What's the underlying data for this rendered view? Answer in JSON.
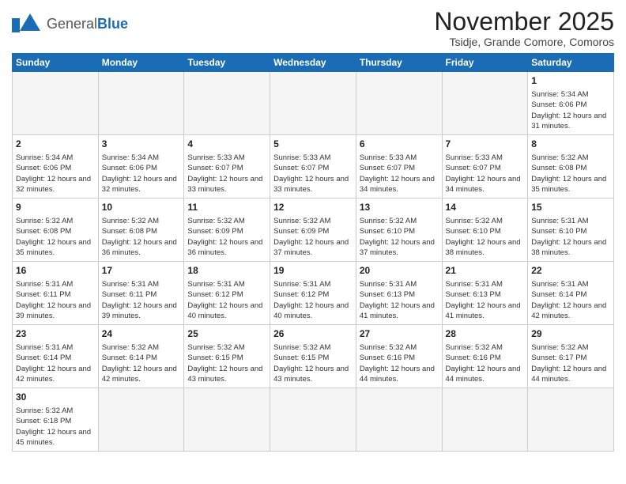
{
  "header": {
    "logo_general": "General",
    "logo_blue": "Blue",
    "month_title": "November 2025",
    "subtitle": "Tsidje, Grande Comore, Comoros"
  },
  "days_of_week": [
    "Sunday",
    "Monday",
    "Tuesday",
    "Wednesday",
    "Thursday",
    "Friday",
    "Saturday"
  ],
  "weeks": [
    [
      {
        "date": "",
        "info": ""
      },
      {
        "date": "",
        "info": ""
      },
      {
        "date": "",
        "info": ""
      },
      {
        "date": "",
        "info": ""
      },
      {
        "date": "",
        "info": ""
      },
      {
        "date": "",
        "info": ""
      },
      {
        "date": "1",
        "info": "Sunrise: 5:34 AM\nSunset: 6:06 PM\nDaylight: 12 hours and 31 minutes."
      }
    ],
    [
      {
        "date": "2",
        "info": "Sunrise: 5:34 AM\nSunset: 6:06 PM\nDaylight: 12 hours and 32 minutes."
      },
      {
        "date": "3",
        "info": "Sunrise: 5:34 AM\nSunset: 6:06 PM\nDaylight: 12 hours and 32 minutes."
      },
      {
        "date": "4",
        "info": "Sunrise: 5:33 AM\nSunset: 6:07 PM\nDaylight: 12 hours and 33 minutes."
      },
      {
        "date": "5",
        "info": "Sunrise: 5:33 AM\nSunset: 6:07 PM\nDaylight: 12 hours and 33 minutes."
      },
      {
        "date": "6",
        "info": "Sunrise: 5:33 AM\nSunset: 6:07 PM\nDaylight: 12 hours and 34 minutes."
      },
      {
        "date": "7",
        "info": "Sunrise: 5:33 AM\nSunset: 6:07 PM\nDaylight: 12 hours and 34 minutes."
      },
      {
        "date": "8",
        "info": "Sunrise: 5:32 AM\nSunset: 6:08 PM\nDaylight: 12 hours and 35 minutes."
      }
    ],
    [
      {
        "date": "9",
        "info": "Sunrise: 5:32 AM\nSunset: 6:08 PM\nDaylight: 12 hours and 35 minutes."
      },
      {
        "date": "10",
        "info": "Sunrise: 5:32 AM\nSunset: 6:08 PM\nDaylight: 12 hours and 36 minutes."
      },
      {
        "date": "11",
        "info": "Sunrise: 5:32 AM\nSunset: 6:09 PM\nDaylight: 12 hours and 36 minutes."
      },
      {
        "date": "12",
        "info": "Sunrise: 5:32 AM\nSunset: 6:09 PM\nDaylight: 12 hours and 37 minutes."
      },
      {
        "date": "13",
        "info": "Sunrise: 5:32 AM\nSunset: 6:10 PM\nDaylight: 12 hours and 37 minutes."
      },
      {
        "date": "14",
        "info": "Sunrise: 5:32 AM\nSunset: 6:10 PM\nDaylight: 12 hours and 38 minutes."
      },
      {
        "date": "15",
        "info": "Sunrise: 5:31 AM\nSunset: 6:10 PM\nDaylight: 12 hours and 38 minutes."
      }
    ],
    [
      {
        "date": "16",
        "info": "Sunrise: 5:31 AM\nSunset: 6:11 PM\nDaylight: 12 hours and 39 minutes."
      },
      {
        "date": "17",
        "info": "Sunrise: 5:31 AM\nSunset: 6:11 PM\nDaylight: 12 hours and 39 minutes."
      },
      {
        "date": "18",
        "info": "Sunrise: 5:31 AM\nSunset: 6:12 PM\nDaylight: 12 hours and 40 minutes."
      },
      {
        "date": "19",
        "info": "Sunrise: 5:31 AM\nSunset: 6:12 PM\nDaylight: 12 hours and 40 minutes."
      },
      {
        "date": "20",
        "info": "Sunrise: 5:31 AM\nSunset: 6:13 PM\nDaylight: 12 hours and 41 minutes."
      },
      {
        "date": "21",
        "info": "Sunrise: 5:31 AM\nSunset: 6:13 PM\nDaylight: 12 hours and 41 minutes."
      },
      {
        "date": "22",
        "info": "Sunrise: 5:31 AM\nSunset: 6:14 PM\nDaylight: 12 hours and 42 minutes."
      }
    ],
    [
      {
        "date": "23",
        "info": "Sunrise: 5:31 AM\nSunset: 6:14 PM\nDaylight: 12 hours and 42 minutes."
      },
      {
        "date": "24",
        "info": "Sunrise: 5:32 AM\nSunset: 6:14 PM\nDaylight: 12 hours and 42 minutes."
      },
      {
        "date": "25",
        "info": "Sunrise: 5:32 AM\nSunset: 6:15 PM\nDaylight: 12 hours and 43 minutes."
      },
      {
        "date": "26",
        "info": "Sunrise: 5:32 AM\nSunset: 6:15 PM\nDaylight: 12 hours and 43 minutes."
      },
      {
        "date": "27",
        "info": "Sunrise: 5:32 AM\nSunset: 6:16 PM\nDaylight: 12 hours and 44 minutes."
      },
      {
        "date": "28",
        "info": "Sunrise: 5:32 AM\nSunset: 6:16 PM\nDaylight: 12 hours and 44 minutes."
      },
      {
        "date": "29",
        "info": "Sunrise: 5:32 AM\nSunset: 6:17 PM\nDaylight: 12 hours and 44 minutes."
      }
    ],
    [
      {
        "date": "30",
        "info": "Sunrise: 5:32 AM\nSunset: 6:18 PM\nDaylight: 12 hours and 45 minutes."
      },
      {
        "date": "",
        "info": ""
      },
      {
        "date": "",
        "info": ""
      },
      {
        "date": "",
        "info": ""
      },
      {
        "date": "",
        "info": ""
      },
      {
        "date": "",
        "info": ""
      },
      {
        "date": "",
        "info": ""
      }
    ]
  ]
}
